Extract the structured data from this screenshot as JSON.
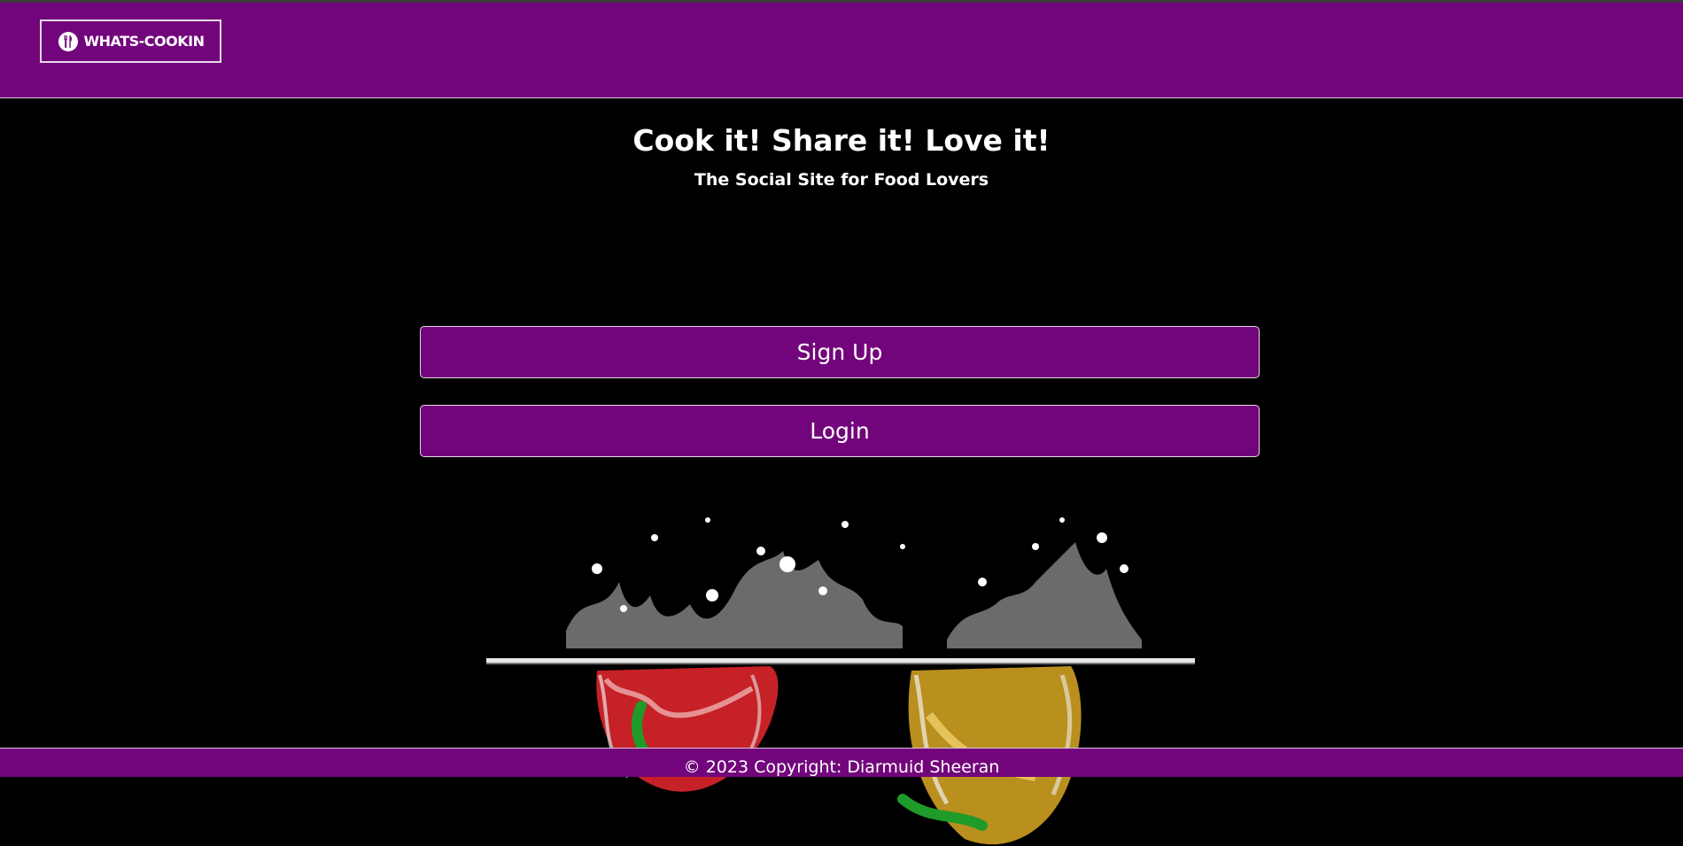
{
  "navbar": {
    "brand_label": "WHATS-COOKIN",
    "brand_icon": "fork-knife-plate-icon"
  },
  "hero": {
    "title": "Cook it! Share it! Love it!",
    "subtitle": "The Social Site for Food Lovers"
  },
  "actions": {
    "signup_label": "Sign Up",
    "login_label": "Login"
  },
  "footer": {
    "copyright": "© 2023 Copyright: Diarmuid Sheeran"
  },
  "colors": {
    "brand_purple": "#73057c",
    "background": "#000000",
    "text": "#ffffff"
  }
}
